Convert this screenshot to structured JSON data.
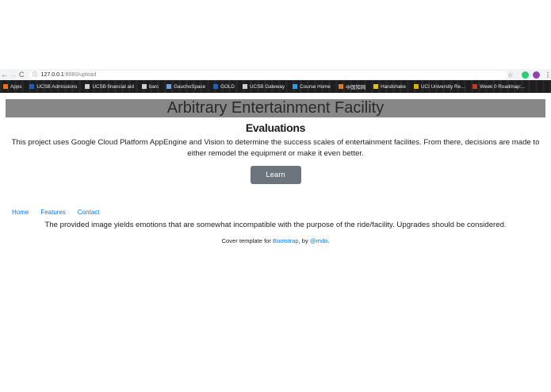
{
  "browser": {
    "url_host": "127.0.0.1",
    "url_rest": ":8080/upload",
    "bookmarks": [
      {
        "label": "Apps",
        "icon": "apps-grid-icon",
        "color": "#e8711a"
      },
      {
        "label": "UCSB Admissions",
        "icon": "ucsb-icon",
        "color": "#1f5fb8"
      },
      {
        "label": "UCSB financial aid",
        "icon": "page-icon",
        "color": "#cfcfcf"
      },
      {
        "label": "barc",
        "icon": "page-icon",
        "color": "#cfcfcf"
      },
      {
        "label": "GauchoSpace",
        "icon": "gauchospace-icon",
        "color": "#6aa0d8"
      },
      {
        "label": "GOLD",
        "icon": "ucsb-icon",
        "color": "#1f5fb8"
      },
      {
        "label": "UCSB Gateway",
        "icon": "page-icon",
        "color": "#cfcfcf"
      },
      {
        "label": "Course Home",
        "icon": "course-icon",
        "color": "#2f9be0"
      },
      {
        "label": "中国知网",
        "icon": "cnki-icon",
        "color": "#d87a2a"
      },
      {
        "label": "Handshake",
        "icon": "handshake-icon",
        "color": "#e0c21f"
      },
      {
        "label": "UCI University Re...",
        "icon": "uci-icon",
        "color": "#e0b000"
      },
      {
        "label": "Week 0 Roadmap:...",
        "icon": "roadmap-icon",
        "color": "#c0392b"
      }
    ]
  },
  "page": {
    "masthead": "Arbitrary Entertainment Facility",
    "lead_title": "Evaluations",
    "lead_text": "This project uses Google Cloud Platform AppEngine and Vision to determine the success scales of entertainment facilites. From there, decisions are made to either remodel the equipment or make it even better.",
    "button_label": "Learn more",
    "nav": [
      "Home",
      "Features",
      "Contact"
    ],
    "result": "The provided image yields emotions that are somewhat incompatible with the purpose of the ride/facility. Upgrades should be considered.",
    "footer": {
      "prefix": "Cover template for ",
      "link1": "Bootstrap",
      "middle": ", by ",
      "link2": "@mdo",
      "suffix": "."
    }
  }
}
